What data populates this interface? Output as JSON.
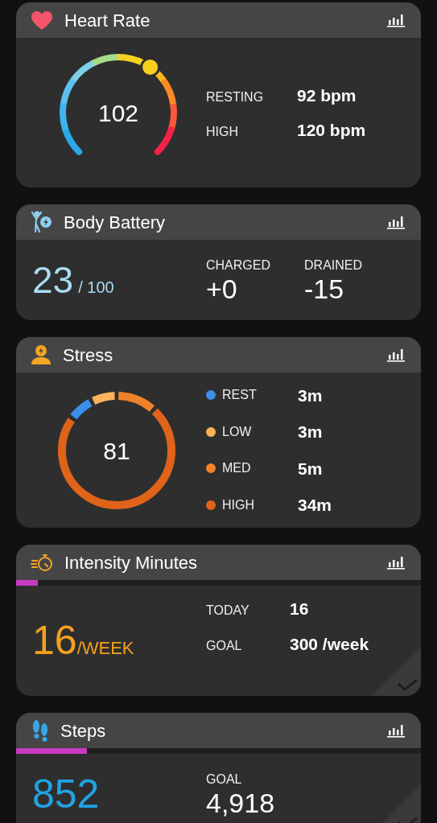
{
  "cards": [
    {
      "kind": "heart",
      "title": "Heart Rate",
      "gauge": {
        "value": "102"
      },
      "stats": [
        {
          "label": "RESTING",
          "value": "92 bpm"
        },
        {
          "label": "HIGH",
          "value": "120 bpm"
        }
      ]
    },
    {
      "kind": "battery",
      "title": "Body Battery",
      "reading": {
        "value": "23",
        "unit": "/ 100"
      },
      "stats": [
        {
          "label": "CHARGED",
          "value": "+0"
        },
        {
          "label": "DRAINED",
          "value": "-15"
        }
      ]
    },
    {
      "kind": "stress",
      "title": "Stress",
      "gauge": {
        "value": "81"
      },
      "legend": [
        {
          "label": "REST",
          "value": "3m",
          "color": "#3d8fe8"
        },
        {
          "label": "LOW",
          "value": "3m",
          "color": "#fbb25b"
        },
        {
          "label": "MED",
          "value": "5m",
          "color": "#f0822a"
        },
        {
          "label": "HIGH",
          "value": "34m",
          "color": "#e0631a"
        }
      ]
    },
    {
      "kind": "intensity",
      "title": "Intensity Minutes",
      "progress": {
        "level": 0.053
      },
      "reading": {
        "value": "16",
        "unit": "/WEEK"
      },
      "stats": [
        {
          "label": "TODAY",
          "value": "16"
        },
        {
          "label": "GOAL",
          "value": "300 /week"
        }
      ],
      "goal_met": true
    },
    {
      "kind": "steps",
      "title": "Steps",
      "progress": {
        "level": 0.175
      },
      "reading": {
        "value": "852"
      },
      "stats": [
        {
          "label": "GOAL",
          "value": "4,918"
        }
      ],
      "goal_met": true
    }
  ]
}
